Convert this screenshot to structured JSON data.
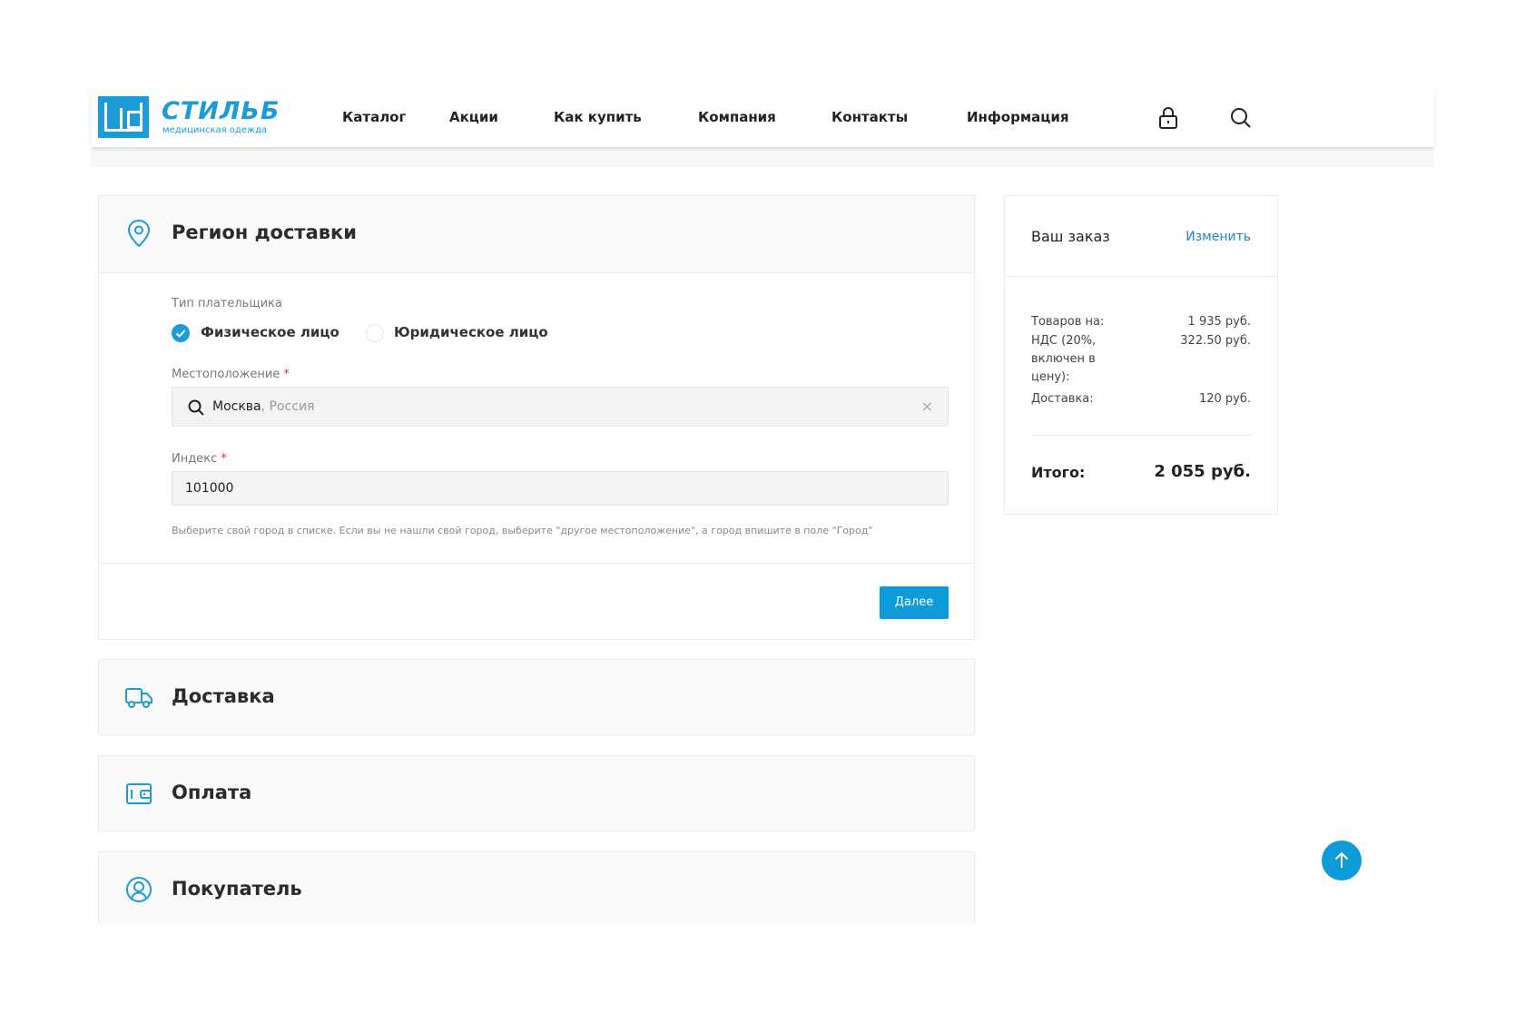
{
  "brand": {
    "name": "СТИЛЬБ",
    "tagline": "медицинская одежда",
    "color": "#1b9bd7"
  },
  "nav": {
    "items": [
      "Каталог",
      "Акции",
      "Как купить",
      "Компания",
      "Контакты",
      "Информация"
    ],
    "icons": [
      "lock-icon",
      "search-icon"
    ]
  },
  "sections": {
    "region": {
      "title": "Региoн доставки",
      "payer_type_label": "Тип плательщика",
      "payer_options": [
        {
          "label": "Физическое лицо",
          "selected": true
        },
        {
          "label": "Юридическое лицо",
          "selected": false
        }
      ],
      "location_label": "Местоположение",
      "location_city": "Москва",
      "location_country": ", Россия",
      "clear_symbol": "×",
      "index_label": "Индекс",
      "index_value": "101000",
      "required_mark": "*",
      "hint": "Выберите свой город в списке. Если вы не нашли свой город, выберите \"другое местоположение\", а город впишите в поле \"Город\"",
      "next_button": "Далее"
    },
    "delivery": {
      "title": "Доставка"
    },
    "payment": {
      "title": "Оплата"
    },
    "buyer": {
      "title": "Покупатель"
    }
  },
  "summary": {
    "title": "Ваш заказ",
    "edit_link": "Изменить",
    "rows": [
      {
        "label": "Товаров на:",
        "value": "1 935 руб."
      },
      {
        "label": "НДС (20%, включен в цену):",
        "value": "322.50 руб."
      },
      {
        "label": "Доставка:",
        "value": "120 руб."
      }
    ],
    "total_label": "Итого:",
    "total_value": "2 055 руб."
  },
  "colors": {
    "accent": "#0e9bd9",
    "link": "#1b87c9",
    "required": "#e0373a"
  }
}
